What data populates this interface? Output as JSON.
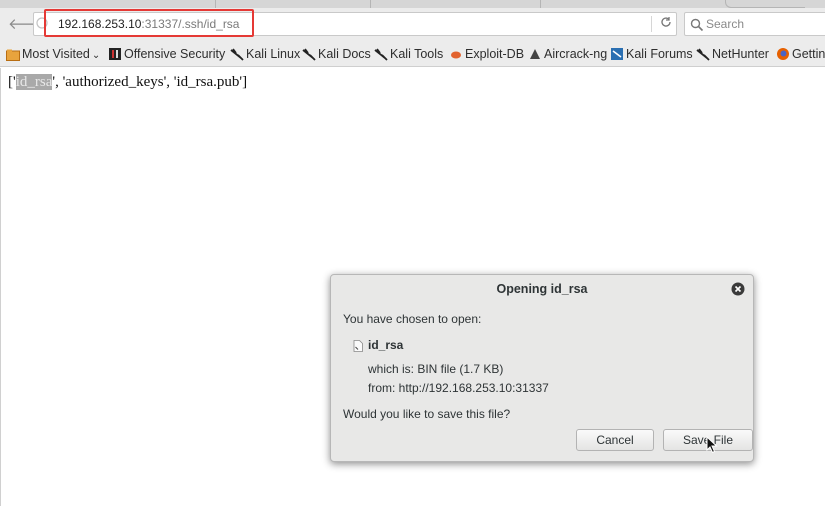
{
  "browser": {
    "url_host": "192.168.253.10",
    "url_path": ":31337/.ssh/id_rsa",
    "search_placeholder": "Search"
  },
  "bookmarks": [
    {
      "label": "Most Visited",
      "icon": "folder-icon"
    },
    {
      "label": "Offensive Security",
      "icon": "offensive-security-icon"
    },
    {
      "label": "Kali Linux",
      "icon": "kali-dragon-icon"
    },
    {
      "label": "Kali Docs",
      "icon": "kali-dragon-icon"
    },
    {
      "label": "Kali Tools",
      "icon": "kali-dragon-icon"
    },
    {
      "label": "Exploit-DB",
      "icon": "exploit-db-icon"
    },
    {
      "label": "Aircrack-ng",
      "icon": "aircrack-icon"
    },
    {
      "label": "Kali Forums",
      "icon": "kali-forums-icon"
    },
    {
      "label": "NetHunter",
      "icon": "kali-dragon-icon"
    },
    {
      "label": "Gettin",
      "icon": "firefox-icon"
    }
  ],
  "page": {
    "open_bracket": "['",
    "selected": "id_rsa",
    "rest": "', 'authorized_keys', 'id_rsa.pub']"
  },
  "dialog": {
    "title": "Opening id_rsa",
    "intro": "You have chosen to open:",
    "filename": "id_rsa",
    "which_is": "which is: BIN file (1.7 KB)",
    "from": "from: http://192.168.253.10:31337",
    "question": "Would you like to save this file?",
    "cancel_label": "Cancel",
    "save_label": "Save File"
  },
  "colors": {
    "highlight_box": "#e53935",
    "selection": "#a9a9a9"
  }
}
